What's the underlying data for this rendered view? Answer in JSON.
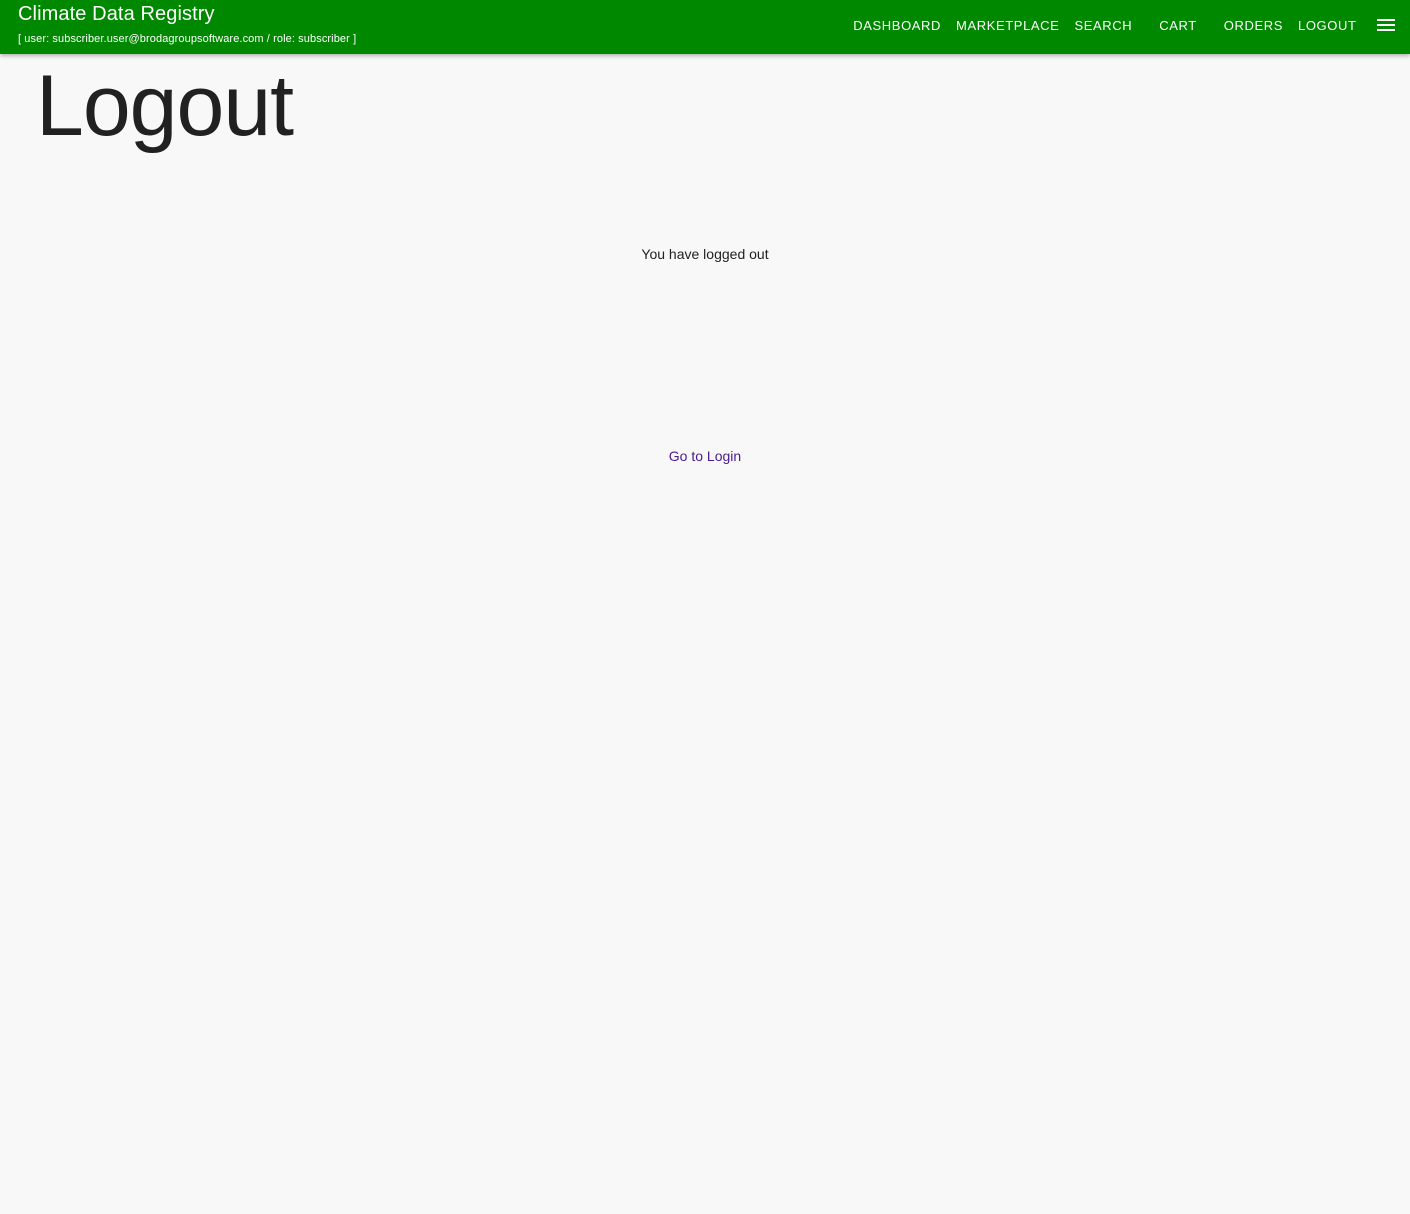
{
  "header": {
    "title": "Climate Data Registry",
    "user_info": "[ user: subscriber.user@brodagroupsoftware.com / role: subscriber ]",
    "nav": {
      "dashboard": "DASHBOARD",
      "marketplace": "MARKETPLACE",
      "search": "SEARCH",
      "cart": "CART",
      "orders": "ORDERS",
      "logout": "LOGOUT"
    },
    "menu_icon": "hamburger-menu-icon"
  },
  "main": {
    "page_title": "Logout",
    "message": "You have logged out",
    "login_link": "Go to Login"
  },
  "colors": {
    "header_bg": "#008800",
    "page_bg": "#f8f8f8",
    "link": "#4b1a8c"
  }
}
